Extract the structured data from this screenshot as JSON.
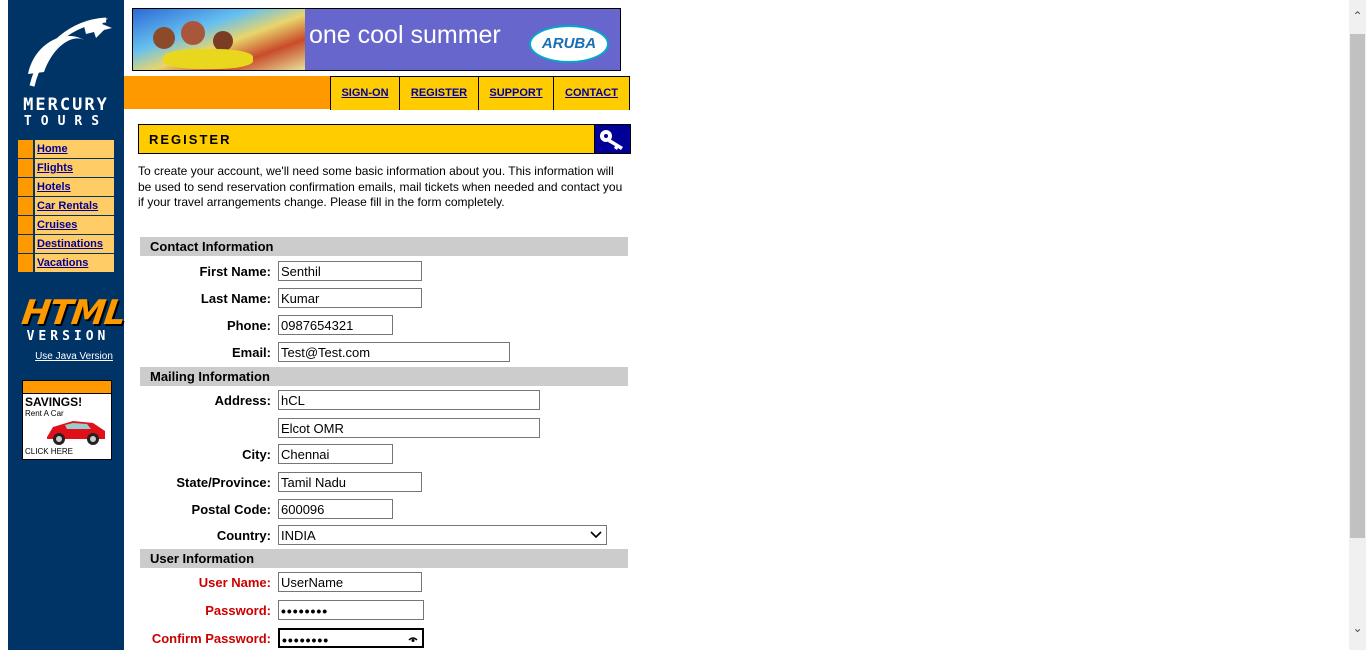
{
  "brand": {
    "line1": "MERCURY",
    "line2": "TOURS"
  },
  "sidebar_nav": [
    {
      "label": "Home"
    },
    {
      "label": "Flights"
    },
    {
      "label": "Hotels"
    },
    {
      "label": "Car Rentals"
    },
    {
      "label": "Cruises"
    },
    {
      "label": "Destinations"
    },
    {
      "label": "Vacations"
    }
  ],
  "html_version": {
    "word1": "HTML",
    "word2": "VERSION",
    "java_link": "Use Java Version"
  },
  "ad": {
    "headline": "SAVINGS!",
    "sub": "Rent A Car",
    "cta": "CLICK HERE"
  },
  "banner": {
    "text": "one cool summer",
    "logo": "ARUBA"
  },
  "top_nav": [
    {
      "label": "SIGN-ON"
    },
    {
      "label": "REGISTER"
    },
    {
      "label": "SUPPORT"
    },
    {
      "label": "CONTACT"
    }
  ],
  "page_heading": "REGISTER",
  "intro": "To create your account, we'll need some basic information about you. This information will be used to send reservation confirmation emails, mail tickets when needed and contact you if your travel arrangements change. Please fill in the form completely.",
  "sections": {
    "contact": "Contact Information",
    "mailing": "Mailing Information",
    "user": "User Information"
  },
  "fields": {
    "first_name": {
      "label": "First Name:",
      "value": "Senthil"
    },
    "last_name": {
      "label": "Last Name:",
      "value": "Kumar"
    },
    "phone": {
      "label": "Phone:",
      "value": "0987654321"
    },
    "email": {
      "label": "Email:",
      "value": "Test@Test.com"
    },
    "address": {
      "label": "Address:",
      "value": "hCL",
      "value2": "Elcot OMR"
    },
    "city": {
      "label": "City:",
      "value": "Chennai"
    },
    "state": {
      "label": "State/Province:",
      "value": "Tamil Nadu"
    },
    "postal": {
      "label": "Postal Code:",
      "value": "600096"
    },
    "country": {
      "label": "Country:",
      "value": "INDIA"
    },
    "username": {
      "label": "User Name:",
      "value": "UserName"
    },
    "password": {
      "label": "Password:",
      "value": "••••••••"
    },
    "confirm": {
      "label": "Confirm Password:",
      "value": "••••••••"
    }
  },
  "colors": {
    "sidebar": "#003366",
    "orange": "#ff9900",
    "yellow": "#ffcc00",
    "required_label": "#cc0000"
  }
}
